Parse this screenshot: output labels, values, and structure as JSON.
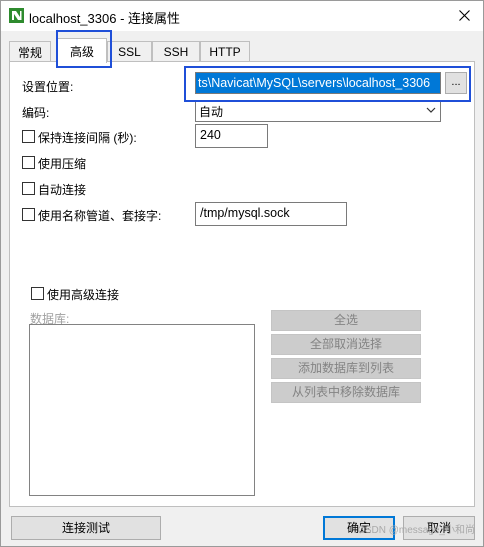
{
  "window": {
    "title": "localhost_3306 - 连接属性",
    "accent_color": "#1f4fd8"
  },
  "tabs": [
    {
      "label": "常规"
    },
    {
      "label": "高级",
      "active": true
    },
    {
      "label": "SSL"
    },
    {
      "label": "SSH"
    },
    {
      "label": "HTTP"
    }
  ],
  "settings": {
    "location_label": "设置位置:",
    "location_value": "ts\\Navicat\\MySQL\\servers\\localhost_3306",
    "browse_label": "...",
    "encoding_label": "编码:",
    "encoding_value": "自动",
    "keepalive_label": "保持连接间隔 (秒):",
    "keepalive_value": "240",
    "compression_label": "使用压缩",
    "autoconnect_label": "自动连接",
    "named_pipe_label": "使用名称管道、套接字:",
    "named_pipe_value": "/tmp/mysql.sock"
  },
  "advanced": {
    "use_advanced_label": "使用高级连接",
    "databases_label": "数据库:",
    "buttons": {
      "select_all": "全选",
      "deselect_all": "全部取消选择",
      "add_to_list": "添加数据库到列表",
      "remove_from_list": "从列表中移除数据库"
    }
  },
  "footer": {
    "test_label": "连接测试",
    "ok_label": "确定",
    "cancel_label": "取消",
    "watermark": "CSDN @message_小和尚"
  }
}
